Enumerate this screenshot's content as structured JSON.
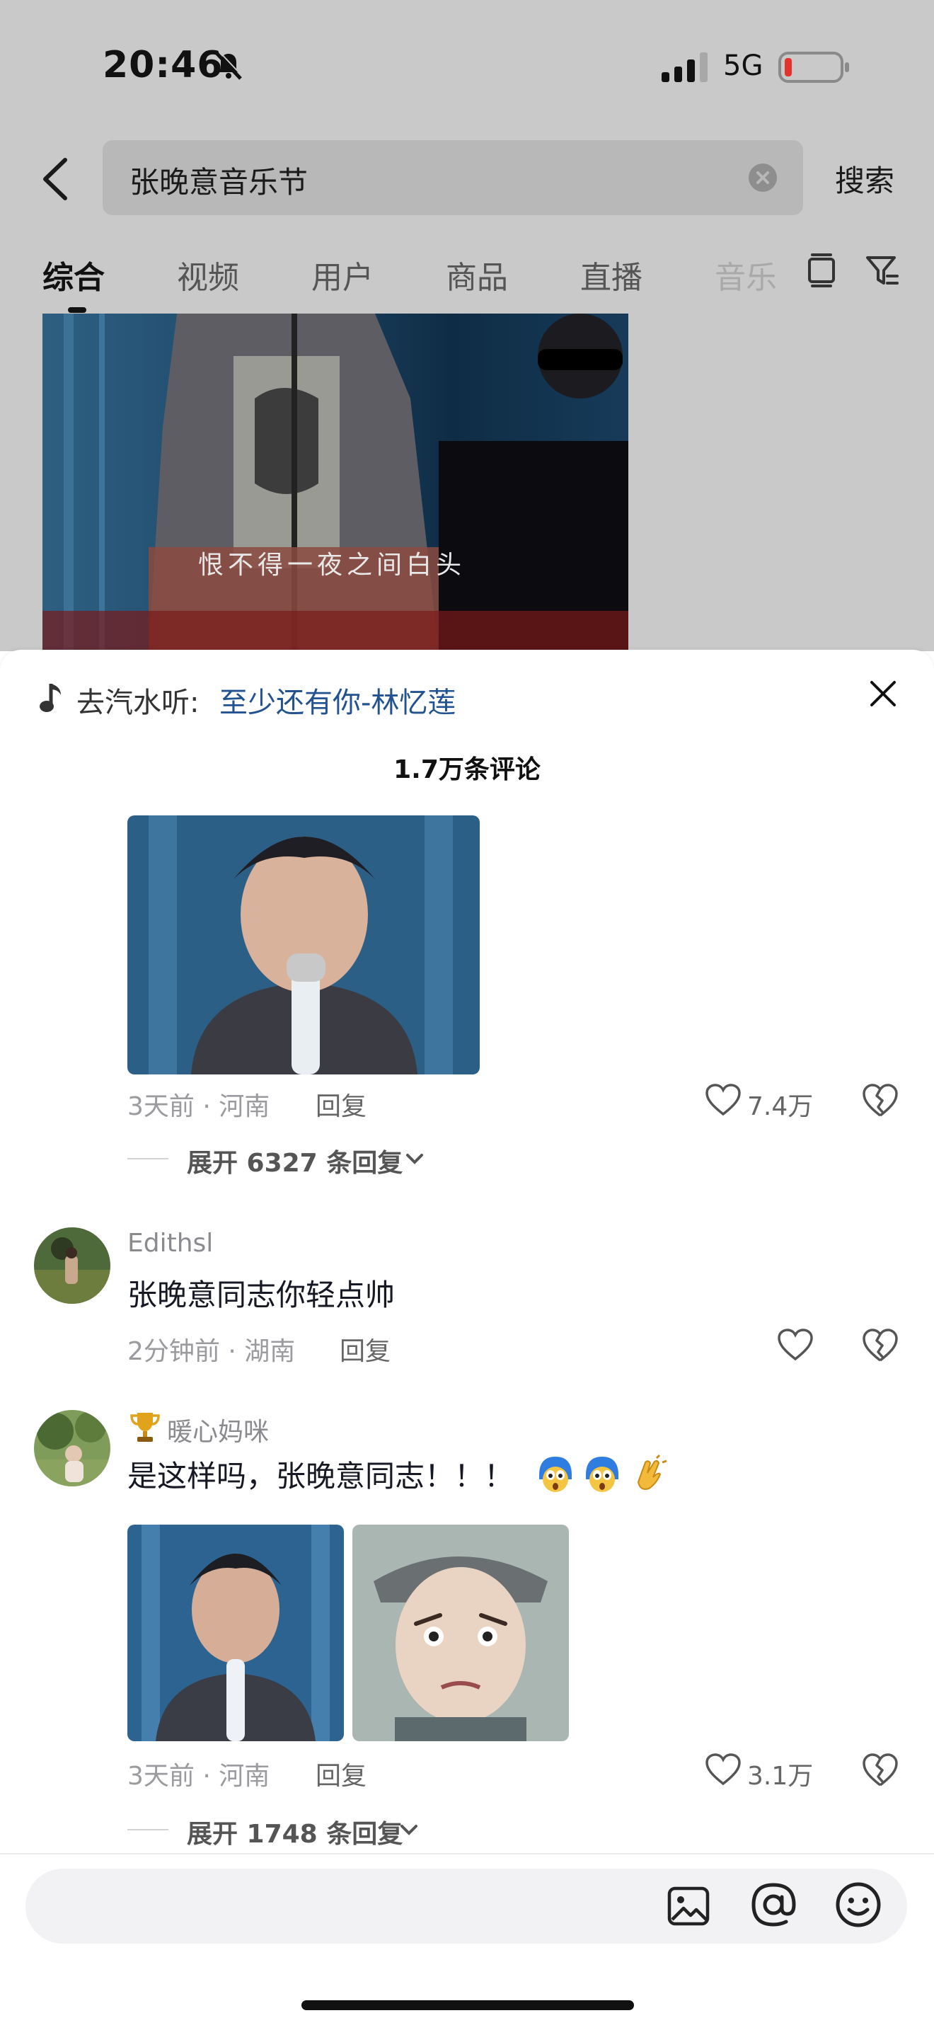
{
  "status_bar": {
    "time": "20:46",
    "network": "5G"
  },
  "search": {
    "query": "张晚意音乐节",
    "button": "搜索"
  },
  "tabs": [
    {
      "label": "综合",
      "active": true
    },
    {
      "label": "视频"
    },
    {
      "label": "用户"
    },
    {
      "label": "商品"
    },
    {
      "label": "直播"
    },
    {
      "label": "音乐"
    }
  ],
  "video": {
    "subtitle": "恨不得一夜之间白头"
  },
  "comment_sheet": {
    "music_prefix": "去汽水听:",
    "music_link": "至少还有你-林忆莲",
    "comment_count": "1.7万条评论",
    "comments": [
      {
        "meta": "3天前 · 河南",
        "reply_label": "回复",
        "likes": "7.4万",
        "expand": "展开 6327 条回复"
      },
      {
        "username": "Edithsl",
        "text": "张晚意同志你轻点帅",
        "meta": "2分钟前 · 湖南",
        "reply_label": "回复"
      },
      {
        "username": "暖心妈咪",
        "text": "是这样吗，张晚意同志！！！",
        "meta": "3天前 · 河南",
        "reply_label": "回复",
        "likes": "3.1万",
        "expand": "展开 1748 条回复"
      }
    ]
  },
  "colors": {
    "link": "#22528f",
    "battery_low": "#e5322d",
    "muted": "#9a9a9f"
  }
}
